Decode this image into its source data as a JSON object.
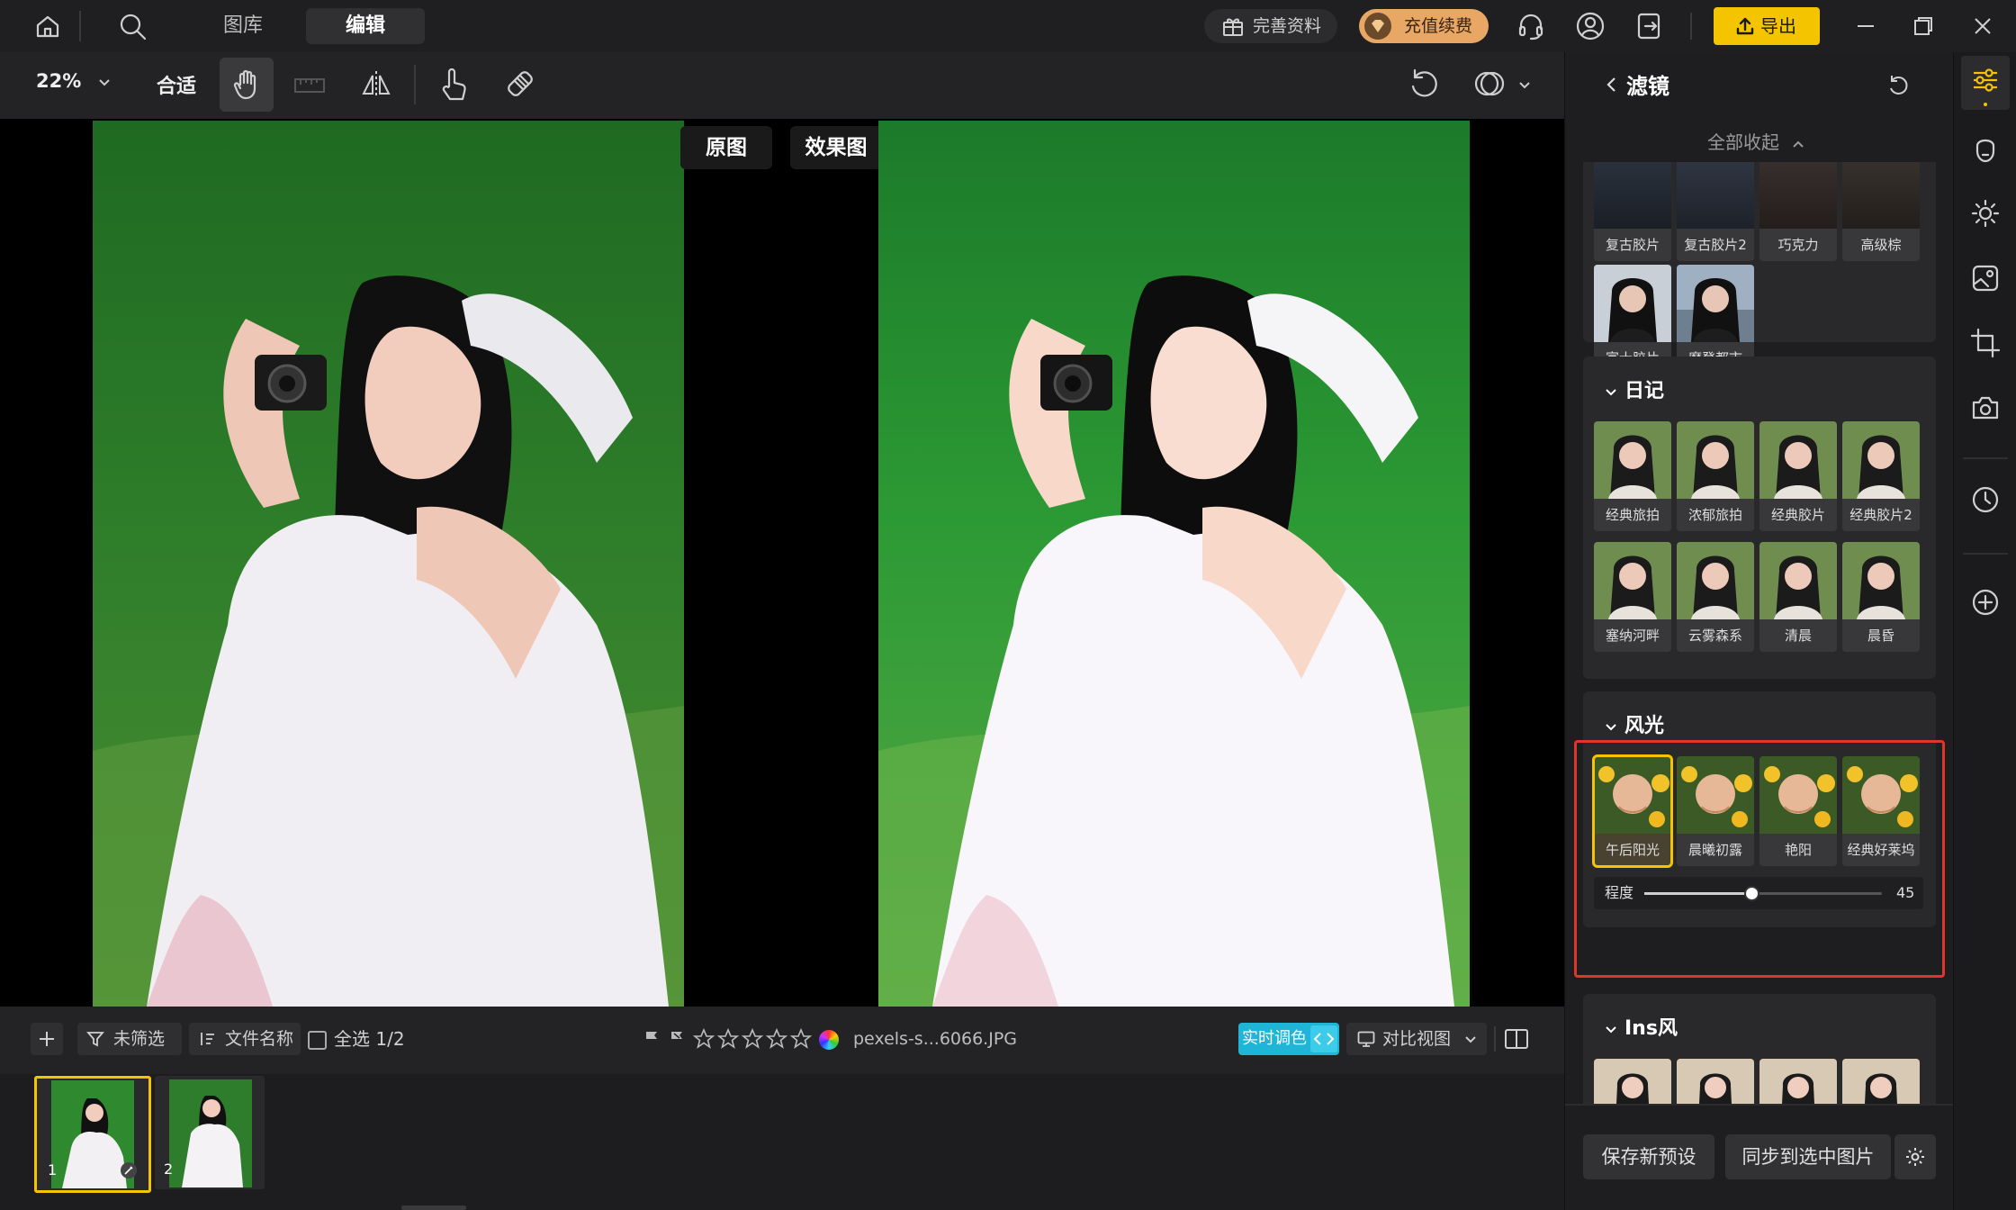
{
  "titlebar": {
    "tabs": [
      "图库",
      "编辑"
    ],
    "active_tab": "编辑",
    "complete_profile": "完善资料",
    "recharge": "充值续费",
    "export": "导出"
  },
  "toolbar": {
    "zoom": "22%",
    "fit": "合适"
  },
  "canvas": {
    "original_label": "原图",
    "effect_label": "效果图"
  },
  "bottombar": {
    "filter": "未筛选",
    "sort": "文件名称",
    "select_all": "全选 1/2",
    "filename": "pexels-s...6066.JPG",
    "realtime": "实时调色",
    "compare_view": "对比视图"
  },
  "filmstrip": [
    {
      "index": "1"
    },
    {
      "index": "2"
    }
  ],
  "panel": {
    "title": "滤镜",
    "collapse_all": "全部收起",
    "group_top": {
      "row1": [
        "复古胶片",
        "复古胶片2",
        "巧克力",
        "高级棕"
      ],
      "row2": [
        "富士胶片",
        "摩登都市"
      ]
    },
    "group_diary": {
      "title": "日记",
      "row1": [
        "经典旅拍",
        "浓郁旅拍",
        "经典胶片",
        "经典胶片2"
      ],
      "row2": [
        "塞纳河畔",
        "云雾森系",
        "清晨",
        "晨昏"
      ]
    },
    "group_scenery": {
      "title": "风光",
      "items": [
        "午后阳光",
        "晨曦初露",
        "艳阳",
        "经典好莱坞"
      ],
      "degree_label": "程度",
      "degree_value": "45",
      "degree_fraction": 0.45
    },
    "group_ins": {
      "title": "Ins风"
    },
    "save_preset": "保存新预设",
    "sync": "同步到选中图片"
  },
  "colors": {
    "accent_yellow": "#f5c400",
    "highlight_red": "#e0352b",
    "realtime_cyan": "#1fb5d6",
    "recharge_gold": "#e8a765"
  }
}
